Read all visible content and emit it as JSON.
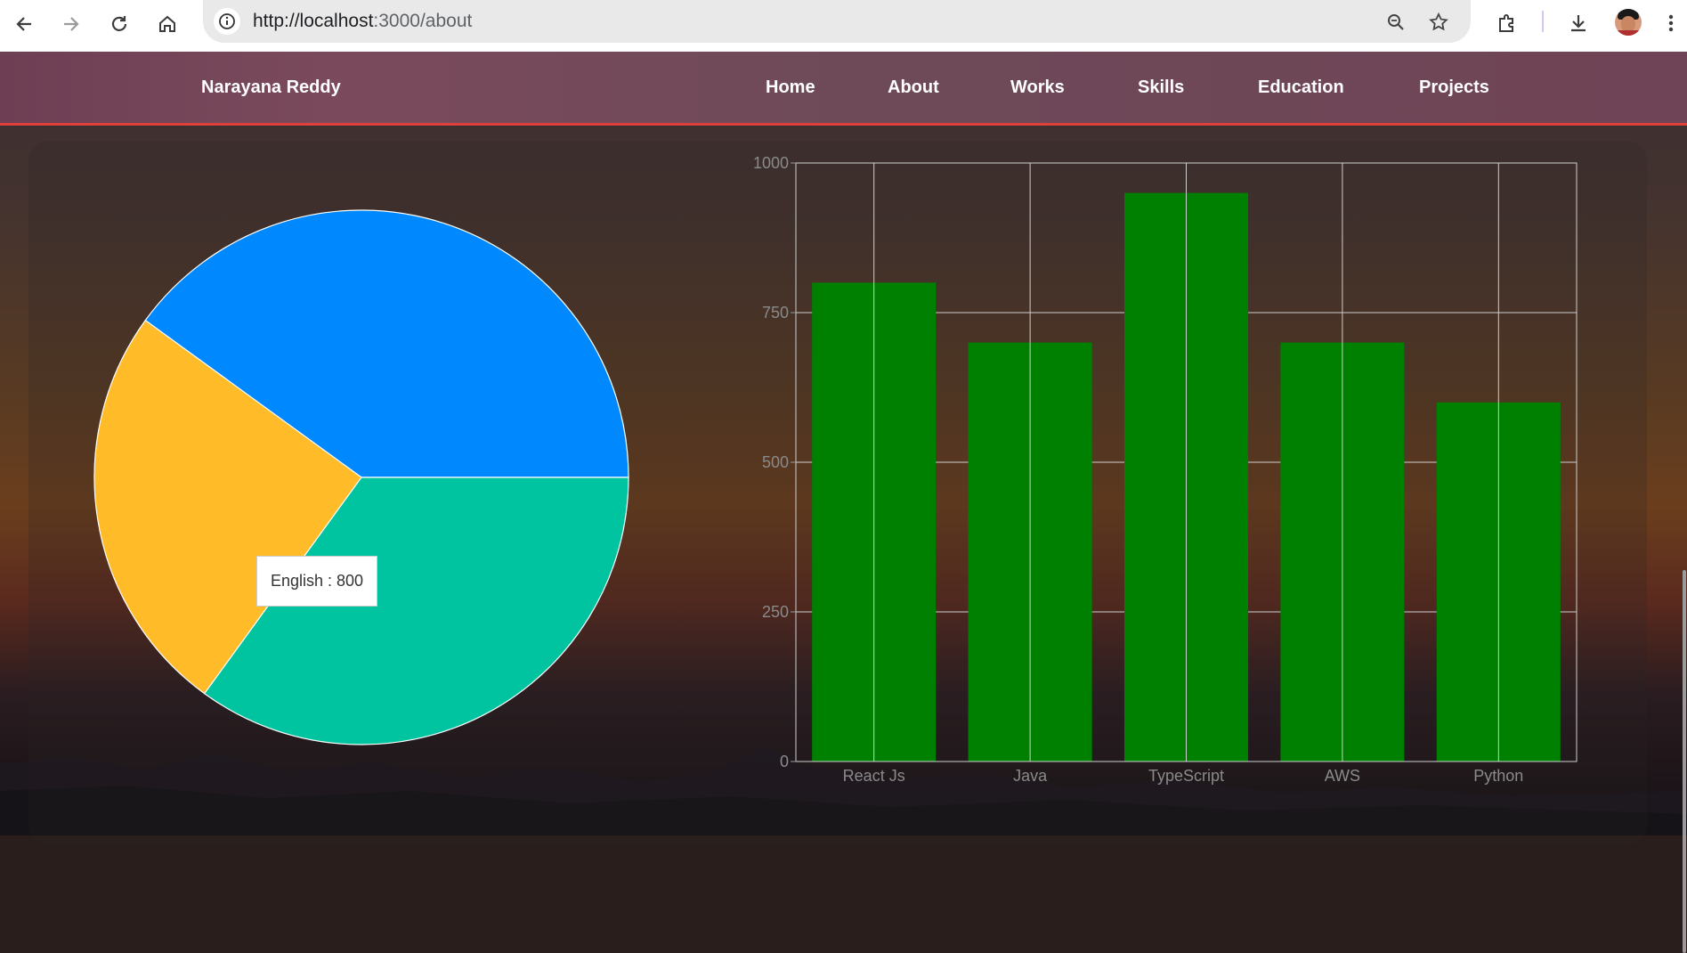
{
  "browser": {
    "url_host": "http://localhost",
    "url_path": ":3000/about",
    "icons": {
      "back": "arrow-left-icon",
      "forward": "arrow-right-icon",
      "reload": "reload-icon",
      "home": "home-icon",
      "info": "info-icon",
      "zoom": "zoom-icon",
      "bookmark": "star-icon",
      "extensions": "puzzle-icon",
      "download": "download-icon",
      "menu": "kebab-menu-icon"
    }
  },
  "site": {
    "brand": "Narayana Reddy",
    "nav": [
      "Home",
      "About",
      "Works",
      "Skills",
      "Education",
      "Projects"
    ]
  },
  "pie_tooltip": "English : 800",
  "chart_data": [
    {
      "type": "pie",
      "slices": [
        {
          "value": 0.4,
          "color": "#0088fe"
        },
        {
          "value": 0.25,
          "color": "#ffbb28"
        },
        {
          "value": 0.35,
          "color": "#00c49f"
        }
      ],
      "tooltip": "English : 800"
    },
    {
      "type": "bar",
      "categories": [
        "React Js",
        "Java",
        "TypeScript",
        "AWS",
        "Python"
      ],
      "values": [
        800,
        700,
        950,
        700,
        600
      ],
      "bar_color": "#008000",
      "ylim": [
        0,
        1000
      ],
      "yticks": [
        "0",
        "250",
        "500",
        "750",
        "1000"
      ],
      "grid": true
    }
  ]
}
